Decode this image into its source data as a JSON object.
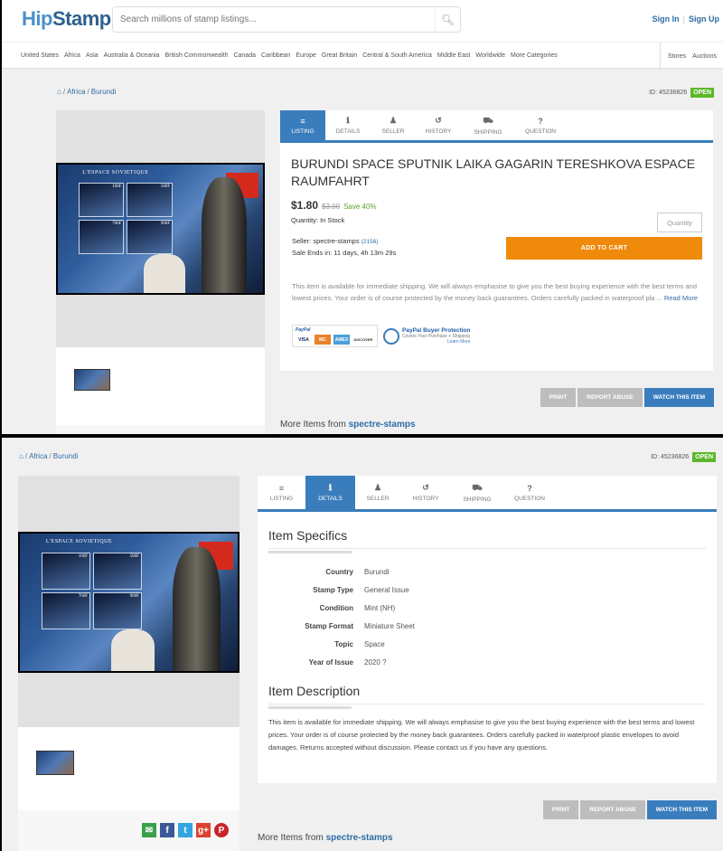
{
  "header": {
    "logo_hip": "Hip",
    "logo_stamp": "Stamp",
    "search_placeholder": "Search millions of stamp listings...",
    "search_icon": "search-icon",
    "sign_in": "Sign In",
    "separator": "|",
    "sign_up": "Sign Up"
  },
  "categories": [
    "United States",
    "Africa",
    "Asia",
    "Australia & Oceania",
    "British Commonwealth",
    "Canada",
    "Caribbean",
    "Europe",
    "Great Britain",
    "Central & South America",
    "Middle East",
    "Worldwide",
    "More Categories"
  ],
  "right_nav": [
    "Stores",
    "Auctions"
  ],
  "breadcrumb": {
    "home_icon": "home-icon",
    "sep": "/",
    "items": [
      "Africa",
      "Burundi"
    ]
  },
  "listing_id": "ID: 45236826",
  "status_badge": "OPEN",
  "status_color": "#5cb82a",
  "accent_color": "#3a7dbd",
  "cart_color": "#ef8a0c",
  "stamp_image": {
    "title": "L'ESPACE SOVIETIQUE",
    "values": [
      "100F",
      "500F",
      "700F",
      "900F"
    ]
  },
  "tabs": [
    {
      "label": "LISTING",
      "icon": "list-icon",
      "glyph": "≡"
    },
    {
      "label": "DETAILS",
      "icon": "info-icon",
      "glyph": "ℹ"
    },
    {
      "label": "SELLER",
      "icon": "user-icon",
      "glyph": "♟"
    },
    {
      "label": "HISTORY",
      "icon": "history-icon",
      "glyph": "↺"
    },
    {
      "label": "SHIPPING",
      "icon": "truck-icon",
      "glyph": "⛟"
    },
    {
      "label": "QUESTION",
      "icon": "question-icon",
      "glyph": "?"
    }
  ],
  "listing": {
    "title": "BURUNDI SPACE SPUTNIK LAIKA GAGARIN TERESHKOVA ESPACE RAUMFAHRT",
    "price": "$1.80",
    "old_price": "$3.00",
    "save": "Save 40%",
    "quantity_text": "Quantity: In Stock",
    "quantity_placeholder": "Quantity",
    "seller_label": "Seller: spectre-stamps",
    "seller_rating": "(2156)",
    "sale_ends": "Sale Ends in: 11 days, 4h 13m 29s",
    "add_to_cart": "ADD TO CART",
    "desc_short": "This item is available for immediate shipping. We will always emphasise to give you the best buying experience with the best terms and lowest prices. Your order is of course protected by the money back guarantees. Orders carefully packed in waterproof pla ...",
    "read_more": "Read More",
    "payment": {
      "paypal": "PayPal",
      "cards": [
        "VISA",
        "MC",
        "AMEX",
        "DISCOVER"
      ],
      "protection_title": "PayPal Buyer Protection",
      "protection_sub": "Covers Your Purchase + Shipping",
      "learn_more": "Learn More"
    }
  },
  "actions": {
    "print": "PRINT",
    "report": "REPORT ABUSE",
    "watch": "WATCH THIS ITEM"
  },
  "more_items": {
    "prefix": "More Items from",
    "seller": "spectre-stamps"
  },
  "details": {
    "specifics_heading": "Item Specifics",
    "specifics": [
      {
        "k": "Country",
        "v": "Burundi"
      },
      {
        "k": "Stamp Type",
        "v": "General Issue"
      },
      {
        "k": "Condition",
        "v": "Mint (NH)"
      },
      {
        "k": "Stamp Format",
        "v": "Miniature Sheet"
      },
      {
        "k": "Topic",
        "v": "Space"
      },
      {
        "k": "Year of Issue",
        "v": "2020 ?"
      }
    ],
    "description_heading": "Item Description",
    "description": "This item is available for immediate shipping. We will always emphasise to give you the best buying experience with the best terms and lowest prices. Your order is of course protected by the money back guarantees. Orders carefully packed in waterproof plastic envelopes to avoid damages. Returns accepted without discussion. Please contact us if you have any questions."
  },
  "share_icons": [
    {
      "name": "email-share-icon",
      "glyph": "✉",
      "color": "#3aa04a"
    },
    {
      "name": "facebook-share-icon",
      "glyph": "f",
      "color": "#3b5998"
    },
    {
      "name": "twitter-share-icon",
      "glyph": "t",
      "color": "#33a5e0"
    },
    {
      "name": "google-plus-share-icon",
      "glyph": "g+",
      "color": "#d9432f"
    },
    {
      "name": "pinterest-share-icon",
      "glyph": "P",
      "color": "#c8232c"
    }
  ]
}
